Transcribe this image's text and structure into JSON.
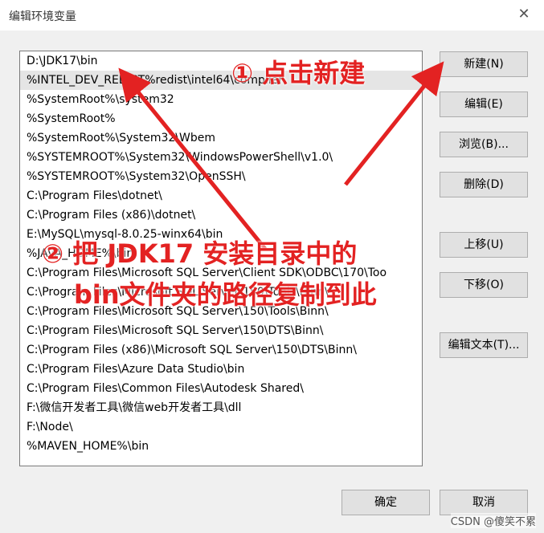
{
  "window": {
    "title": "编辑环境变量"
  },
  "list": {
    "items": [
      "D:\\JDK17\\bin",
      "%INTEL_DEV_REDIST%redist\\intel64\\compiler",
      "%SystemRoot%\\system32",
      "%SystemRoot%",
      "%SystemRoot%\\System32\\Wbem",
      "%SYSTEMROOT%\\System32\\WindowsPowerShell\\v1.0\\",
      "%SYSTEMROOT%\\System32\\OpenSSH\\",
      "C:\\Program Files\\dotnet\\",
      "C:\\Program Files (x86)\\dotnet\\",
      "E:\\MySQL\\mysql-8.0.25-winx64\\bin",
      "%JAVA_HOME%\\bin",
      "C:\\Program Files\\Microsoft SQL Server\\Client SDK\\ODBC\\170\\Too",
      "C:\\Program Files\\Microsoft SQL Server\\150\\Tools\\Binn\\",
      "C:\\Program Files\\Microsoft SQL Server\\150\\Tools\\Binn\\",
      "C:\\Program Files\\Microsoft SQL Server\\150\\DTS\\Binn\\",
      "C:\\Program Files (x86)\\Microsoft SQL Server\\150\\DTS\\Binn\\",
      "C:\\Program Files\\Azure Data Studio\\bin",
      "C:\\Program Files\\Common Files\\Autodesk Shared\\",
      "F:\\微信开发者工具\\微信web开发者工具\\dll",
      "F:\\Node\\",
      "%MAVEN_HOME%\\bin"
    ]
  },
  "buttons": {
    "new": "新建(N)",
    "edit": "编辑(E)",
    "browse": "浏览(B)...",
    "delete": "删除(D)",
    "move_up": "上移(U)",
    "move_down": "下移(O)",
    "edit_text": "编辑文本(T)...",
    "ok": "确定",
    "cancel": "取消"
  },
  "annotations": {
    "step1": "① 点击新建",
    "step2_line1": "② 把 JDK17 安装目录中的",
    "step2_line2": "bin文件夹的路径复制到此"
  },
  "watermark": "CSDN @傻笑不累",
  "colors": {
    "annotation": "#e32222",
    "selected_row": "#e5e5e5"
  }
}
